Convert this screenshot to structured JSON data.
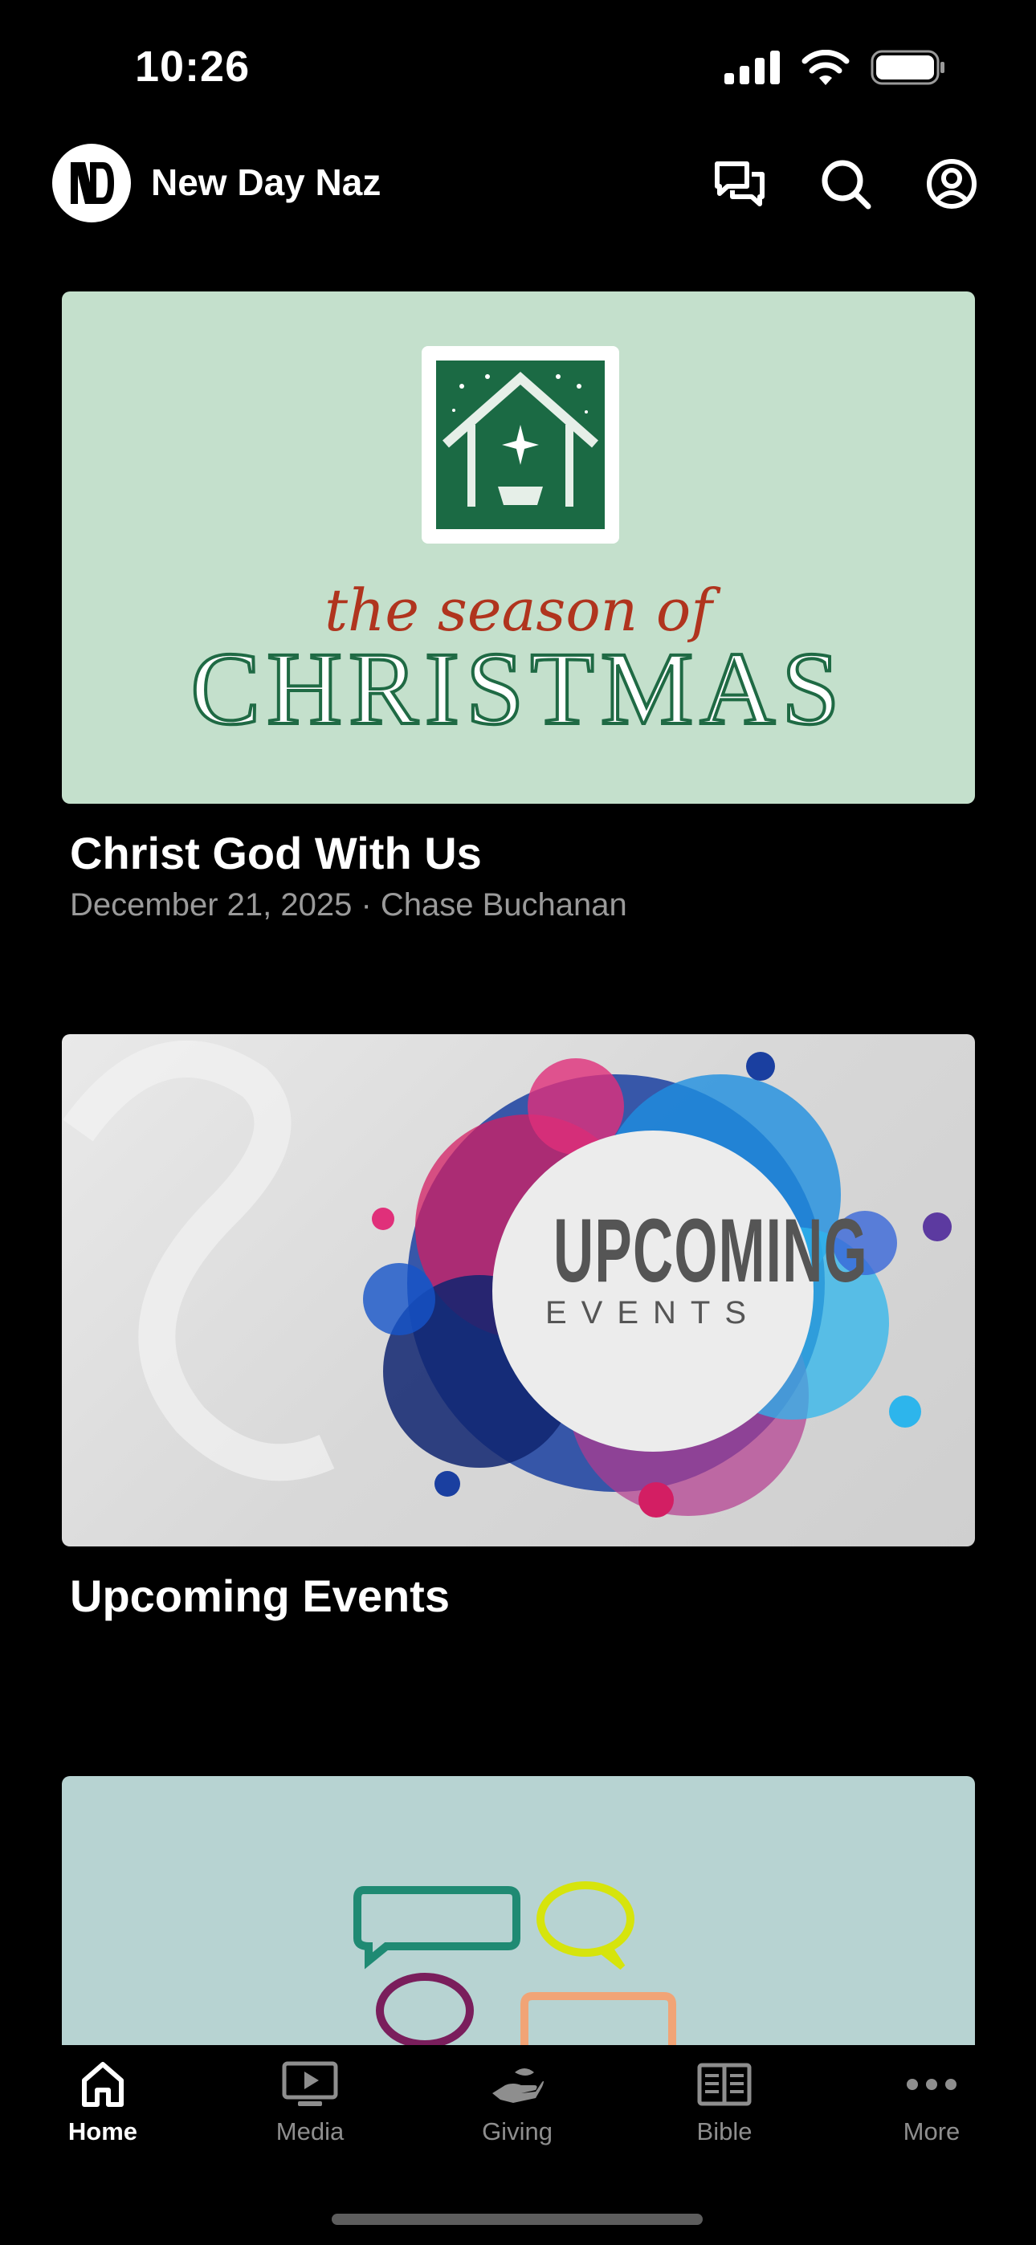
{
  "status_bar": {
    "time": "10:26",
    "icons": [
      "cellular-signal-icon",
      "wifi-icon",
      "battery-icon"
    ]
  },
  "header": {
    "logo_text": "ND",
    "title": "New Day Naz",
    "actions": [
      "chat-icon",
      "search-icon",
      "profile-icon"
    ]
  },
  "feed": {
    "items": [
      {
        "title": "Christ God With Us",
        "meta": "December 21, 2025 · Chase Buchanan",
        "image": {
          "script_text": "the season of",
          "headline_text": "CHRISTMAS",
          "background": "#c4e0cc"
        }
      },
      {
        "title": "Upcoming Events",
        "image": {
          "headline_text": "UPCOMING",
          "sub_text": "EVENTS",
          "background": "#dcdcdc"
        }
      },
      {
        "image": {
          "background": "#b7d3d2"
        }
      }
    ]
  },
  "tab_bar": {
    "tabs": [
      {
        "label": "Home",
        "icon": "home-icon",
        "active": true
      },
      {
        "label": "Media",
        "icon": "media-icon",
        "active": false
      },
      {
        "label": "Giving",
        "icon": "giving-icon",
        "active": false
      },
      {
        "label": "Bible",
        "icon": "bible-icon",
        "active": false
      },
      {
        "label": "More",
        "icon": "more-icon",
        "active": false
      }
    ]
  },
  "colors": {
    "background": "#000000",
    "tab_inactive": "#8e8e8e",
    "meta_text": "#9a9a9a",
    "christmas_green": "#1f6a44",
    "christmas_red": "#b0341e"
  }
}
